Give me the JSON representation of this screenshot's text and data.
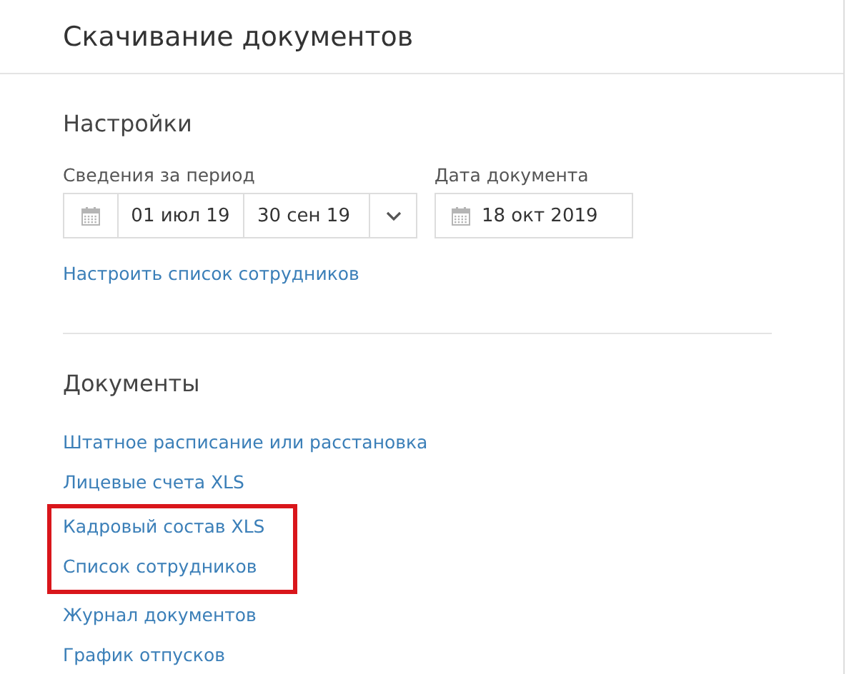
{
  "window": {
    "title": "Скачивание документов"
  },
  "settings": {
    "heading": "Настройки",
    "period": {
      "label": "Сведения за период",
      "from": "01 июл 19",
      "to": "30 сен 19"
    },
    "document_date": {
      "label": "Дата документа",
      "value": "18 окт 2019"
    },
    "link": "Настроить список сотрудников"
  },
  "documents": {
    "heading": "Документы",
    "links": [
      {
        "label": "Штатное расписание или расстановка",
        "highlighted": false
      },
      {
        "label": "Лицевые счета XLS",
        "highlighted": false
      },
      {
        "label": "Кадровый состав XLS",
        "highlighted": true
      },
      {
        "label": "Список сотрудников",
        "highlighted": true
      },
      {
        "label": "Журнал документов",
        "highlighted": false
      },
      {
        "label": "График отпусков",
        "highlighted": false
      }
    ]
  }
}
